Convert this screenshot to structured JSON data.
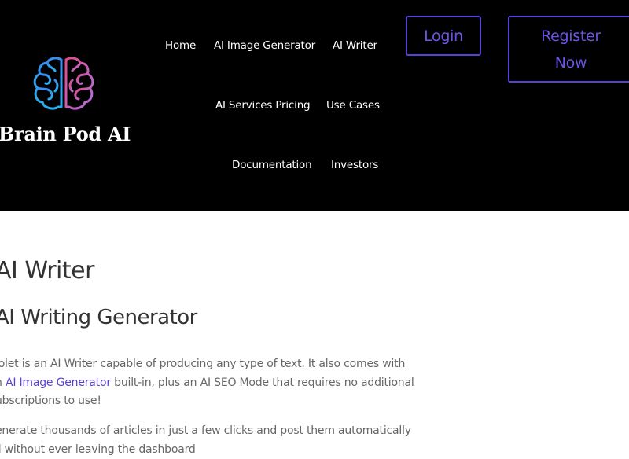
{
  "brand": {
    "name": "Brain Pod AI",
    "logo_icon": "brain-icon",
    "colors": {
      "brain_left": "#3aa0f0",
      "brain_right": "#d060c0",
      "accent": "#5b3fd6"
    }
  },
  "nav": {
    "items": [
      {
        "label": "Home"
      },
      {
        "label": "AI Image Generator"
      },
      {
        "label": "AI Writer"
      },
      {
        "label": "AI Services Pricing"
      },
      {
        "label": "Use Cases"
      },
      {
        "label": "Documentation"
      },
      {
        "label": "Investors"
      }
    ]
  },
  "auth": {
    "login_label": "Login",
    "register_line1": "Register",
    "register_line2": "Now"
  },
  "main": {
    "title": "AI Writer",
    "subtitle": "AI Writing Generator",
    "paragraph1": {
      "line1": "iolet is an AI Writer capable of producing any type of text.  It also comes with",
      "line2_prefix": "n ",
      "line2_link": "AI Image Generator",
      "line2_suffix": " built-in, plus an AI SEO Mode that requires no additional",
      "line3": "ubscriptions to use!"
    },
    "paragraph2": {
      "line1": "enerate thousands of articles in just a few clicks and post them automatically",
      "line2": "ll without ever leaving the dashboard"
    }
  }
}
